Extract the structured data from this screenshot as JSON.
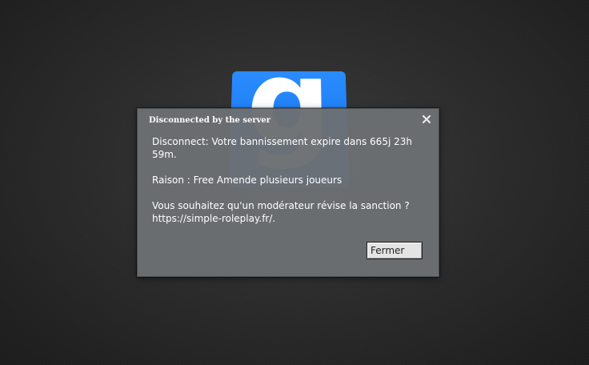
{
  "background": {
    "logo": {
      "glyph": "g",
      "icon": "garrysmod-logo",
      "color": "#1a7df5"
    }
  },
  "dialog": {
    "title": "Disconnected by the server",
    "close_icon": "close-x",
    "message_lines": [
      "Disconnect: Votre bannissement expire dans 665j 23h 59m.",
      "Raison : Free Amende plusieurs joueurs",
      "Vous souhaitez qu'un modérateur révise la sanction ? https://simple-roleplay.fr/."
    ],
    "button_label": "Fermer"
  },
  "colors": {
    "dialog_bg": "#6c7073",
    "button_bg": "#e4e4e4",
    "text": "#ffffff"
  }
}
